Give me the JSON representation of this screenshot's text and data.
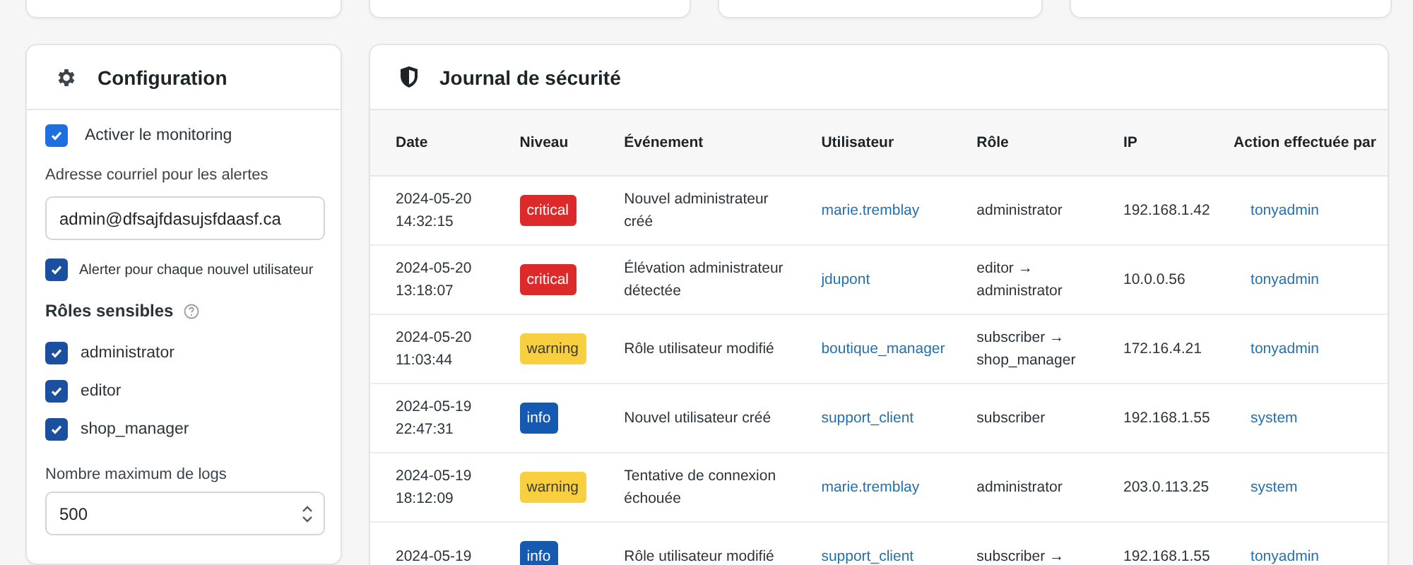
{
  "config": {
    "title": "Configuration",
    "monitoring": {
      "label": "Activer le monitoring",
      "checked": true
    },
    "email": {
      "label": "Adresse courriel pour les alertes",
      "value": "admin@dfsajfdasujsfdaasf.ca"
    },
    "alert_new_user": {
      "label": "Alerter pour chaque nouvel utilisateur",
      "checked": true
    },
    "sensitive_roles": {
      "title": "Rôles sensibles",
      "roles": [
        {
          "label": "administrator",
          "checked": true
        },
        {
          "label": "editor",
          "checked": true
        },
        {
          "label": "shop_manager",
          "checked": true
        }
      ]
    },
    "max_logs": {
      "label": "Nombre maximum de logs",
      "value": "500"
    }
  },
  "journal": {
    "title": "Journal de sécurité",
    "columns": [
      "Date",
      "Niveau",
      "Événement",
      "Utilisateur",
      "Rôle",
      "IP",
      "Action effectuée par"
    ],
    "rows": [
      {
        "date": "2024-05-20",
        "time": "14:32:15",
        "level": "critical",
        "event": "Nouvel administrateur créé",
        "user": "marie.tremblay",
        "role": "administrator",
        "ip": "192.168.1.42",
        "by": "tonyadmin"
      },
      {
        "date": "2024-05-20",
        "time": "13:18:07",
        "level": "critical",
        "event": "Élévation administrateur détectée",
        "user": "jdupont",
        "role": "editor → administrator",
        "ip": "10.0.0.56",
        "by": "tonyadmin"
      },
      {
        "date": "2024-05-20",
        "time": "11:03:44",
        "level": "warning",
        "event": "Rôle utilisateur modifié",
        "user": "boutique_manager",
        "role": "subscriber → shop_manager",
        "ip": "172.16.4.21",
        "by": "tonyadmin"
      },
      {
        "date": "2024-05-19",
        "time": "22:47:31",
        "level": "info",
        "event": "Nouvel utilisateur créé",
        "user": "support_client",
        "role": "subscriber",
        "ip": "192.168.1.55",
        "by": "system"
      },
      {
        "date": "2024-05-19",
        "time": "18:12:09",
        "level": "warning",
        "event": "Tentative de connexion échouée",
        "user": "marie.tremblay",
        "role": "administrator",
        "ip": "203.0.113.25",
        "by": "system"
      },
      {
        "date": "2024-05-19",
        "level": "info",
        "event": "Rôle utilisateur modifié",
        "user": "support_client",
        "role": "subscriber →",
        "ip": "192.168.1.55",
        "by": "tonyadmin"
      }
    ]
  }
}
